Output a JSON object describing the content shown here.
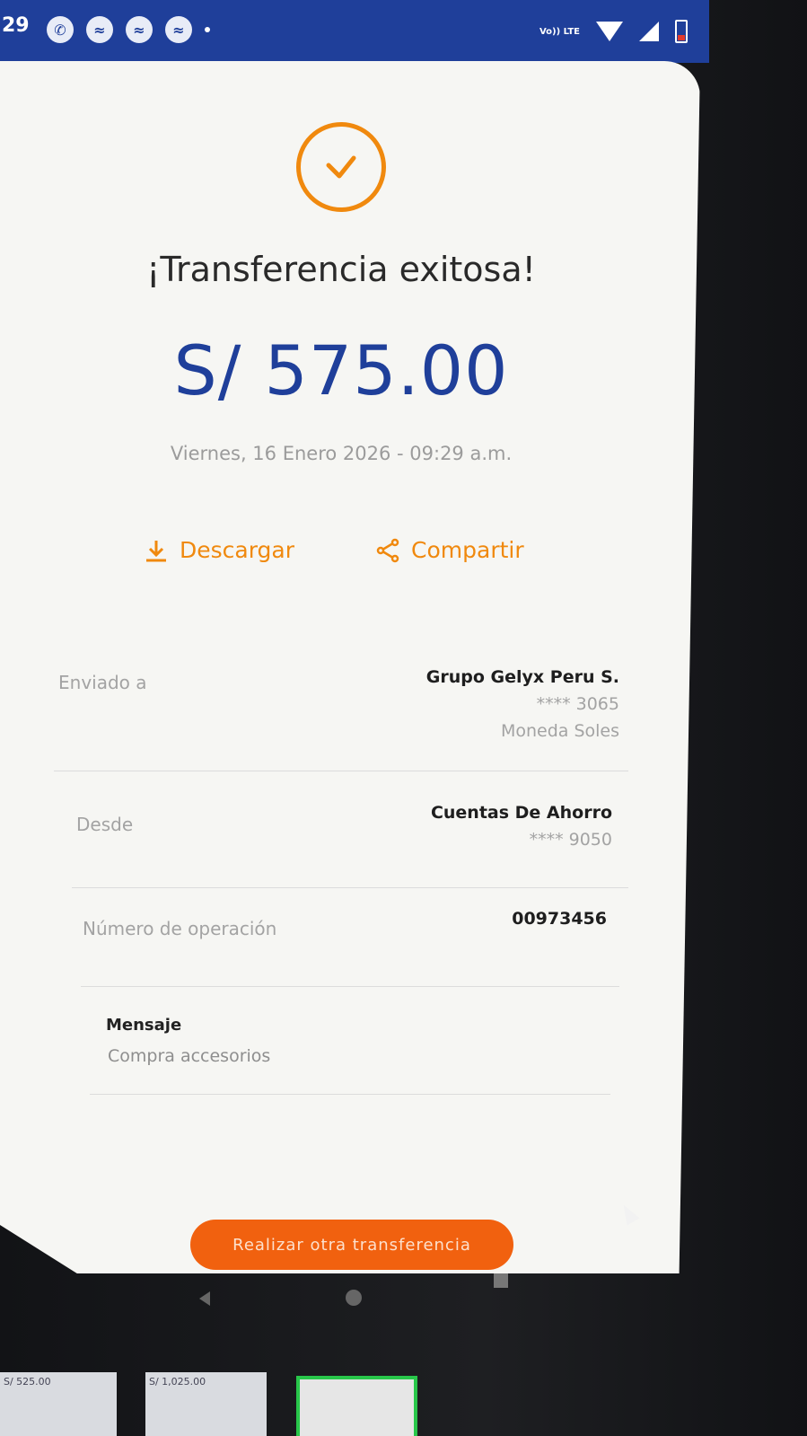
{
  "status_bar": {
    "time": "29",
    "volte_label": "Vo)) LTE"
  },
  "receipt": {
    "title": "¡Transferencia exitosa!",
    "amount": "S/ 575.00",
    "datetime": "Viernes, 16 Enero 2026 - 09:29 a.m.",
    "actions": {
      "download_label": "Descargar",
      "share_label": "Compartir"
    },
    "sent_to": {
      "label": "Enviado a",
      "name": "Grupo Gelyx Peru S.",
      "account": "**** 3065",
      "currency": "Moneda Soles"
    },
    "from": {
      "label": "Desde",
      "account_type": "Cuentas De Ahorro",
      "account": "**** 9050"
    },
    "operation": {
      "label": "Número de operación",
      "number": "00973456"
    },
    "message": {
      "label": "Mensaje",
      "text": "Compra accesorios"
    },
    "cta_label": "Realizar otra transferencia"
  },
  "thumbnails": [
    {
      "text": "S/ 525.00"
    },
    {
      "text": "S/ 1,025.00"
    },
    {
      "text": ""
    }
  ],
  "colors": {
    "accent": "#f0890e",
    "brand_blue": "#1f3f9a",
    "cta": "#f1610f"
  }
}
